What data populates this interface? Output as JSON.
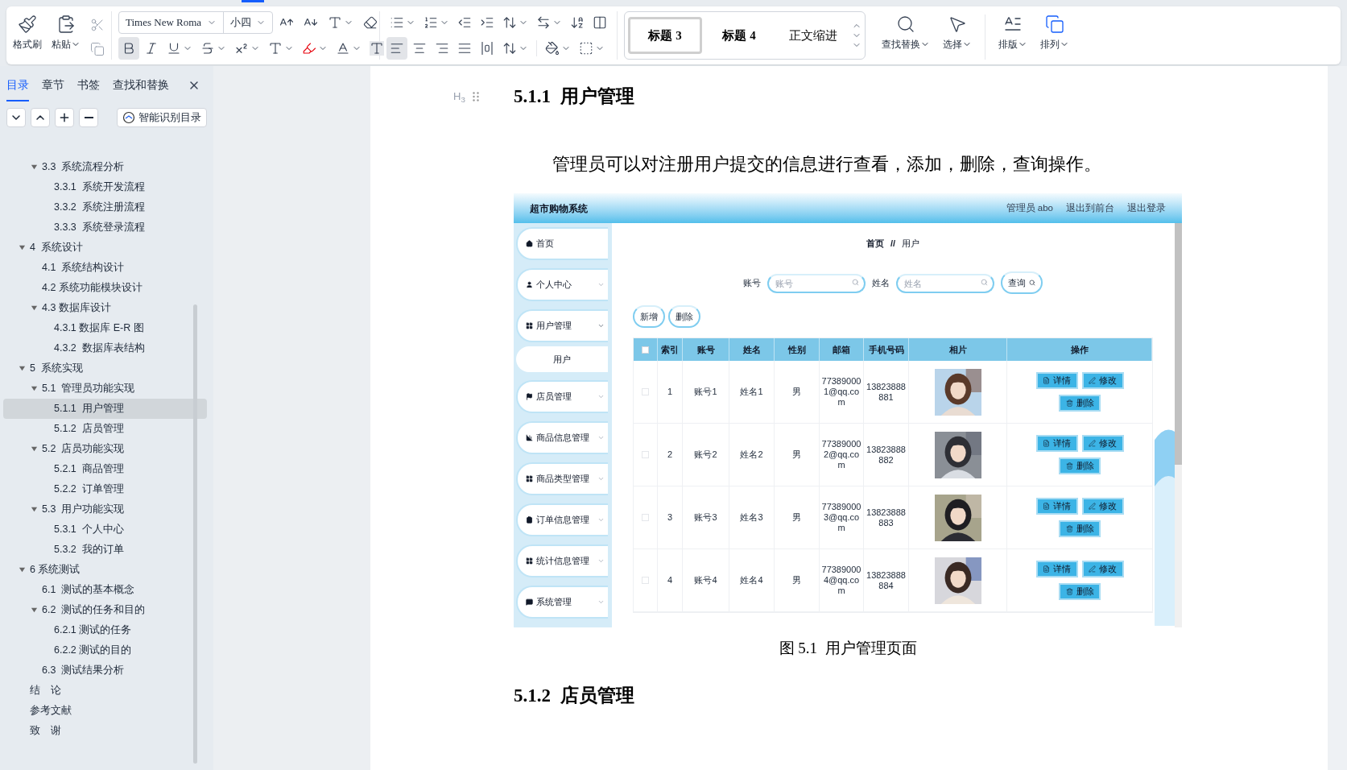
{
  "ribbon": {
    "clipboard": [
      {
        "kind": "brush",
        "label": "格式刷"
      },
      {
        "kind": "paste",
        "label": "粘贴"
      }
    ],
    "font_name": "Times New Roma",
    "font_size": "小四",
    "text_toggles": [
      {
        "kind": "bold",
        "on": true
      },
      {
        "kind": "italic",
        "on": false
      },
      {
        "kind": "underline",
        "on": false
      }
    ],
    "alignments": [
      {
        "kind": "left",
        "selected": true
      },
      {
        "kind": "center",
        "selected": false
      },
      {
        "kind": "right",
        "selected": false
      },
      {
        "kind": "justify",
        "selected": false
      },
      {
        "kind": "distributed",
        "selected": false
      }
    ],
    "styles": [
      {
        "kind": "heading",
        "label": "标题 3",
        "selected": true
      },
      {
        "kind": "heading",
        "label": "标题 4",
        "selected": false
      },
      {
        "kind": "body",
        "label": "正文缩进",
        "selected": false
      }
    ],
    "tools": [
      {
        "kind": "find",
        "label": "查找替换"
      },
      {
        "kind": "select",
        "label": "选择"
      },
      {
        "kind": "layout",
        "label": "排版"
      },
      {
        "kind": "arrange",
        "label": "排列"
      }
    ]
  },
  "sidebar": {
    "tabs": [
      {
        "label": "目录",
        "selected": true
      },
      {
        "label": "章节",
        "selected": false
      },
      {
        "label": "书签",
        "selected": false
      },
      {
        "label": "查找和替换",
        "selected": false
      }
    ],
    "smart_button": "智能识别目录",
    "toc": [
      {
        "children": [
          {
            "label": "3.3  系统流程分析",
            "selected": false,
            "expanded": true,
            "children": [
              {
                "label": "3.3.1  系统开发流程",
                "selected": false
              },
              {
                "label": "3.3.2  系统注册流程",
                "selected": false
              },
              {
                "label": "3.3.3  系统登录流程",
                "selected": false
              }
            ]
          }
        ]
      },
      {
        "label": "4  系统设计",
        "selected": false,
        "expanded": true,
        "children": [
          {
            "label": "4.1  系统结构设计",
            "selected": false
          },
          {
            "label": "4.2 系统功能模块设计",
            "selected": false
          },
          {
            "label": "4.3 数据库设计",
            "selected": false,
            "expanded": true,
            "children": [
              {
                "label": "4.3.1 数据库 E-R 图",
                "selected": false
              },
              {
                "label": "4.3.2  数据库表结构",
                "selected": false
              }
            ]
          }
        ]
      },
      {
        "label": "5  系统实现",
        "selected": false,
        "expanded": true,
        "children": [
          {
            "label": "5.1  管理员功能实现",
            "selected": false,
            "expanded": true,
            "children": [
              {
                "label": "5.1.1  用户管理",
                "selected": true
              },
              {
                "label": "5.1.2  店员管理",
                "selected": false
              }
            ]
          },
          {
            "label": "5.2  店员功能实现",
            "selected": false,
            "expanded": true,
            "children": [
              {
                "label": "5.2.1  商品管理",
                "selected": false
              },
              {
                "label": "5.2.2  订单管理",
                "selected": false
              }
            ]
          },
          {
            "label": "5.3  用户功能实现",
            "selected": false,
            "expanded": true,
            "children": [
              {
                "label": "5.3.1  个人中心",
                "selected": false
              },
              {
                "label": "5.3.2  我的订单",
                "selected": false
              }
            ]
          }
        ]
      },
      {
        "label": "6 系统测试",
        "selected": false,
        "expanded": true,
        "children": [
          {
            "label": "6.1  测试的基本概念",
            "selected": false
          },
          {
            "label": "6.2  测试的任务和目的",
            "selected": false,
            "expanded": true,
            "children": [
              {
                "label": "6.2.1 测试的任务",
                "selected": false
              },
              {
                "label": "6.2.2 测试的目的",
                "selected": false
              }
            ]
          },
          {
            "label": "6.3  测试结果分析",
            "selected": false
          }
        ]
      },
      {
        "label": "结　论",
        "selected": false
      },
      {
        "label": "参考文献",
        "selected": false
      },
      {
        "label": "致　谢",
        "selected": false
      }
    ]
  },
  "document": {
    "heading_marker": "H$_{3}$",
    "heading": "5.1.1  用户管理",
    "paragraph": "管理员可以对注册用户提交的信息进行查看，添加，删除，查询操作。",
    "figure": {
      "app_title": "超市购物系统",
      "header_links": [
        "管理员 abo",
        "退出到前台",
        "退出登录"
      ],
      "menu": [
        {
          "kind": "home",
          "label": "首页"
        },
        {
          "kind": "user",
          "label": "个人中心",
          "expanded": false
        },
        {
          "kind": "grid",
          "label": "用户管理",
          "expanded": true,
          "children": [
            "用户"
          ]
        },
        {
          "kind": "flag",
          "label": "店员管理",
          "expanded": false
        },
        {
          "kind": "chart",
          "label": "商品信息管理",
          "expanded": false
        },
        {
          "kind": "grid",
          "label": "商品类型管理",
          "expanded": false
        },
        {
          "kind": "clipboard",
          "label": "订单信息管理",
          "expanded": false
        },
        {
          "kind": "grid",
          "label": "统计信息管理",
          "expanded": false
        },
        {
          "kind": "chat",
          "label": "系统管理",
          "expanded": false
        }
      ],
      "breadcrumb": [
        "首页",
        "用户"
      ],
      "breadcrumb_separator": "//",
      "search_fields": [
        {
          "label": "账号",
          "placeholder": "账号"
        },
        {
          "label": "姓名",
          "placeholder": "姓名"
        }
      ],
      "search_button": "查询",
      "actions": [
        "新增",
        "删除"
      ],
      "table": {
        "select_all": false,
        "columns": [
          "索引",
          "账号",
          "姓名",
          "性别",
          "邮箱",
          "手机号码",
          "相片",
          "操作"
        ],
        "rows": [
          {
            "checked": false,
            "cells": [
              "1",
              "账号1",
              "姓名1",
              "男",
              "773890001@qq.com",
              "13823888881"
            ],
            "photo": {
              "kind": "picture"
            },
            "actions": [
              "详情",
              "修改",
              "删除"
            ]
          },
          {
            "checked": false,
            "cells": [
              "2",
              "账号2",
              "姓名2",
              "男",
              "773890002@qq.com",
              "13823888882"
            ],
            "photo": {
              "kind": "picture"
            },
            "actions": [
              "详情",
              "修改",
              "删除"
            ]
          },
          {
            "checked": false,
            "cells": [
              "3",
              "账号3",
              "姓名3",
              "男",
              "773890003@qq.com",
              "13823888883"
            ],
            "photo": {
              "kind": "picture"
            },
            "actions": [
              "详情",
              "修改",
              "删除"
            ]
          },
          {
            "checked": false,
            "cells": [
              "4",
              "账号4",
              "姓名4",
              "男",
              "773890004@qq.com",
              "13823888884"
            ],
            "photo": {
              "kind": "picture"
            },
            "actions": [
              "详情",
              "修改",
              "删除"
            ]
          }
        ]
      }
    },
    "caption": "图 5.1  用户管理页面",
    "next_heading": "5.1.2  店员管理"
  }
}
